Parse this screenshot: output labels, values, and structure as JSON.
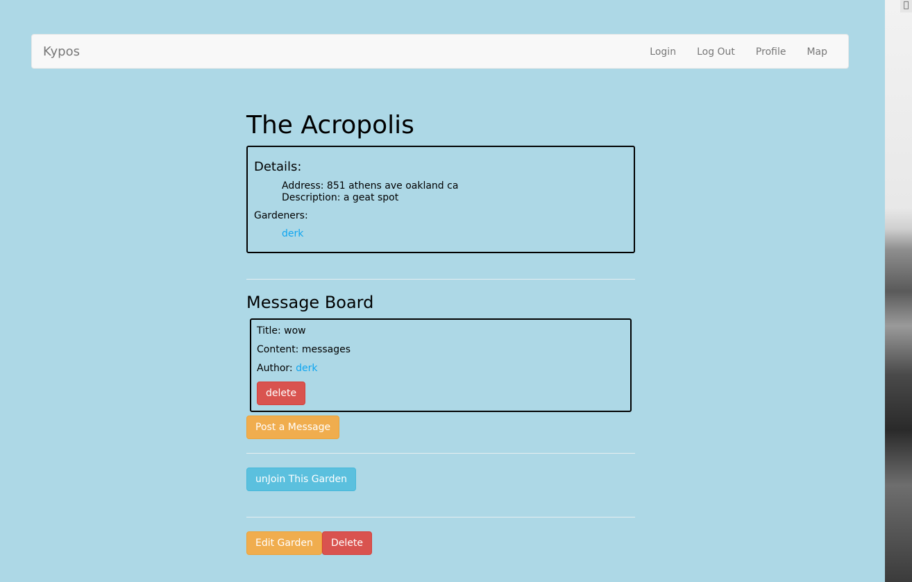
{
  "navbar": {
    "brand": "Kypos",
    "links": [
      "Login",
      "Log Out",
      "Profile",
      "Map"
    ]
  },
  "garden": {
    "title": "The Acropolis",
    "details_heading": "Details:",
    "address": "Address: 851 athens ave oakland ca",
    "description": "Description: a geat spot",
    "gardeners_label": "Gardeners:",
    "gardeners": [
      "derk"
    ]
  },
  "message_board": {
    "title": "Message Board",
    "messages": [
      {
        "title": "Title: wow",
        "content": "Content: messages",
        "author_label": "Author:",
        "author": "derk",
        "delete_label": "delete"
      }
    ],
    "post_button": "Post a Message"
  },
  "actions": {
    "unjoin_button": "unJoin This Garden",
    "edit_button": "Edit Garden",
    "delete_button": "Delete"
  },
  "colors": {
    "background": "#add8e6",
    "link": "#0ea5f0",
    "danger": "#d9534f",
    "warning": "#f0ad4e",
    "info": "#5bc0de"
  }
}
